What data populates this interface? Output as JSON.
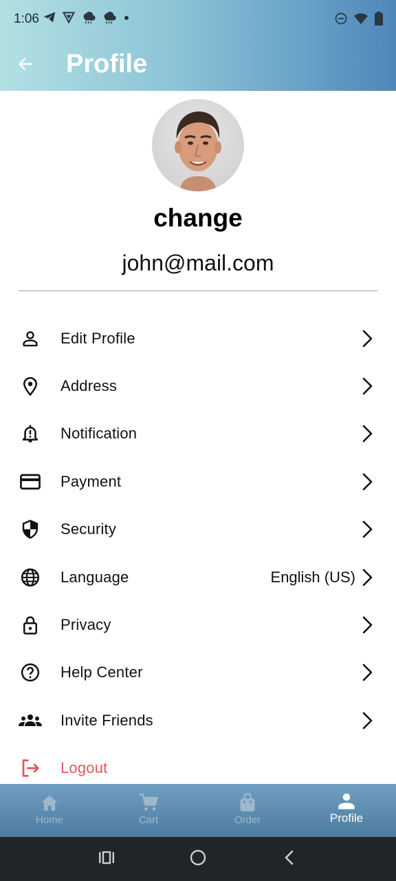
{
  "status_bar": {
    "time": "1:06",
    "left_icons": [
      "telegram-icon",
      "vpn-icon",
      "weather-icon",
      "weather-icon",
      "dot-icon"
    ],
    "right_icons": [
      "dnd-icon",
      "wifi-icon",
      "battery-icon"
    ]
  },
  "app_bar": {
    "title": "Profile",
    "back_icon": "arrow-left-icon"
  },
  "profile": {
    "name": "change",
    "email": "john@mail.com"
  },
  "menu": {
    "items": [
      {
        "label": "Edit Profile",
        "icon": "person-icon"
      },
      {
        "label": "Address",
        "icon": "location-pin-icon"
      },
      {
        "label": "Notification",
        "icon": "bell-alert-icon"
      },
      {
        "label": "Payment",
        "icon": "credit-card-icon"
      },
      {
        "label": "Security",
        "icon": "shield-icon"
      },
      {
        "label": "Language",
        "icon": "globe-icon",
        "value": "English (US)"
      },
      {
        "label": "Privacy",
        "icon": "lock-icon"
      },
      {
        "label": "Help Center",
        "icon": "help-circle-icon"
      },
      {
        "label": "Invite Friends",
        "icon": "group-icon"
      },
      {
        "label": "Logout",
        "icon": "logout-icon"
      }
    ]
  },
  "bottom_nav": {
    "items": [
      {
        "label": "Home",
        "icon": "home-icon",
        "active": false
      },
      {
        "label": "Cart",
        "icon": "cart-icon",
        "active": false
      },
      {
        "label": "Order",
        "icon": "bag-icon",
        "active": false
      },
      {
        "label": "Profile",
        "icon": "person-icon",
        "active": true
      }
    ]
  },
  "colors": {
    "logout": "#e2575a",
    "header_gradient_start": "#b2e0e3",
    "header_gradient_end": "#4f87bb",
    "nav_background": "#5a89ad",
    "system_nav": "#1f2528"
  }
}
